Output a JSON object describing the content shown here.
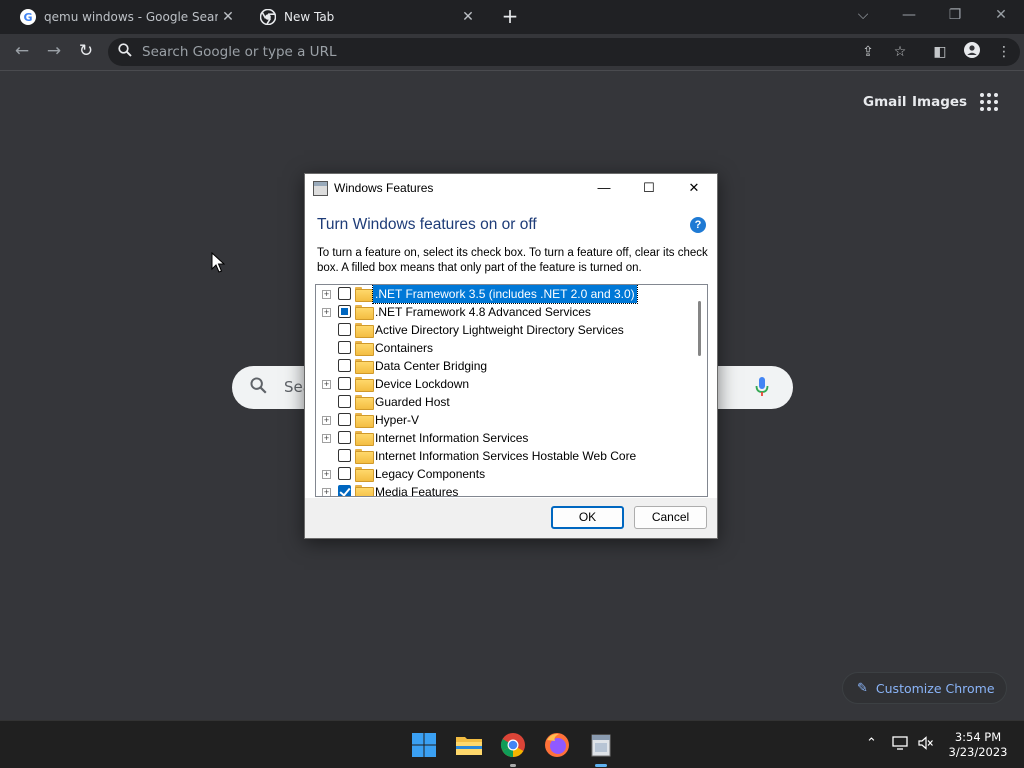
{
  "browser": {
    "tabs": [
      {
        "title": "qemu windows - Google Search"
      },
      {
        "title": "New Tab"
      }
    ],
    "omnibox_placeholder": "Search Google or type a URL"
  },
  "ntp": {
    "links": [
      "Gmail",
      "Images"
    ],
    "search_placeholder": "Sea",
    "customize_label": "Customize Chrome"
  },
  "dialog": {
    "title": "Windows Features",
    "heading": "Turn Windows features on or off",
    "help": "?",
    "description": "To turn a feature on, select its check box. To turn a feature off, clear its check box. A filled box means that only part of the feature is turned on.",
    "features": [
      {
        "label": ".NET Framework 3.5 (includes .NET 2.0 and 3.0)",
        "state": "unchecked",
        "expandable": true,
        "selected": true
      },
      {
        "label": ".NET Framework 4.8 Advanced Services",
        "state": "partial",
        "expandable": true,
        "selected": false
      },
      {
        "label": "Active Directory Lightweight Directory Services",
        "state": "unchecked",
        "expandable": false,
        "selected": false
      },
      {
        "label": "Containers",
        "state": "unchecked",
        "expandable": false,
        "selected": false
      },
      {
        "label": "Data Center Bridging",
        "state": "unchecked",
        "expandable": false,
        "selected": false
      },
      {
        "label": "Device Lockdown",
        "state": "unchecked",
        "expandable": true,
        "selected": false
      },
      {
        "label": "Guarded Host",
        "state": "unchecked",
        "expandable": false,
        "selected": false
      },
      {
        "label": "Hyper-V",
        "state": "unchecked",
        "expandable": true,
        "selected": false
      },
      {
        "label": "Internet Information Services",
        "state": "unchecked",
        "expandable": true,
        "selected": false
      },
      {
        "label": "Internet Information Services Hostable Web Core",
        "state": "unchecked",
        "expandable": false,
        "selected": false
      },
      {
        "label": "Legacy Components",
        "state": "unchecked",
        "expandable": true,
        "selected": false
      },
      {
        "label": "Media Features",
        "state": "checked",
        "expandable": true,
        "selected": false
      }
    ],
    "ok_label": "OK",
    "cancel_label": "Cancel"
  },
  "taskbar": {
    "time": "3:54 PM",
    "date": "3/23/2023",
    "apps": [
      "windows-start-icon",
      "file-explorer-icon",
      "chrome-icon",
      "firefox-icon",
      "windows-features-app-icon"
    ]
  },
  "colors": {
    "chrome_bg": "#35363a",
    "tabstrip_bg": "#202124",
    "dialog_heading": "#1e3c78",
    "selection": "#0078d7",
    "accent": "#0067c0",
    "customize_text": "#8ab4f8"
  }
}
